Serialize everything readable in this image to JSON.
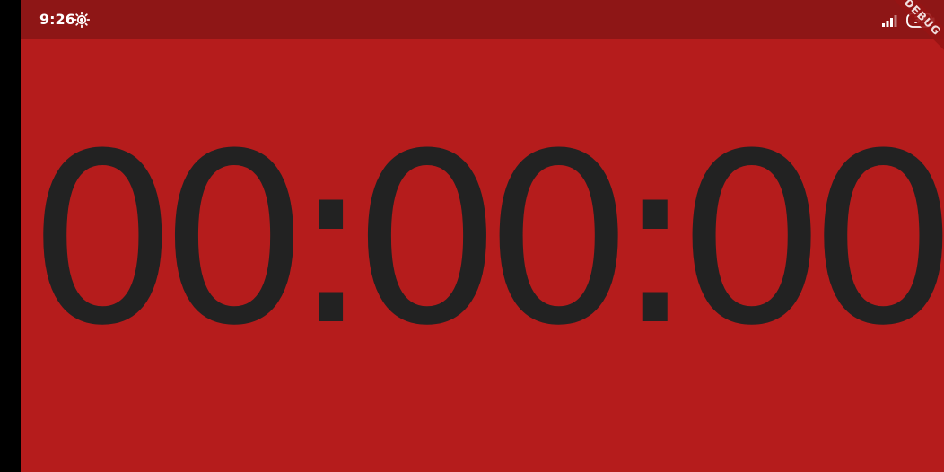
{
  "status_bar": {
    "time": "9:26",
    "battery_level": "33",
    "icons": {
      "brightness": "brightness-icon",
      "signal": "signal-icon",
      "battery": "battery-icon"
    }
  },
  "debug_banner": {
    "label": "DEBUG"
  },
  "timer": {
    "display": "00:00:00"
  },
  "colors": {
    "background": "#B51C1C",
    "status_bar": "#8E1616",
    "digits": "#222222"
  }
}
